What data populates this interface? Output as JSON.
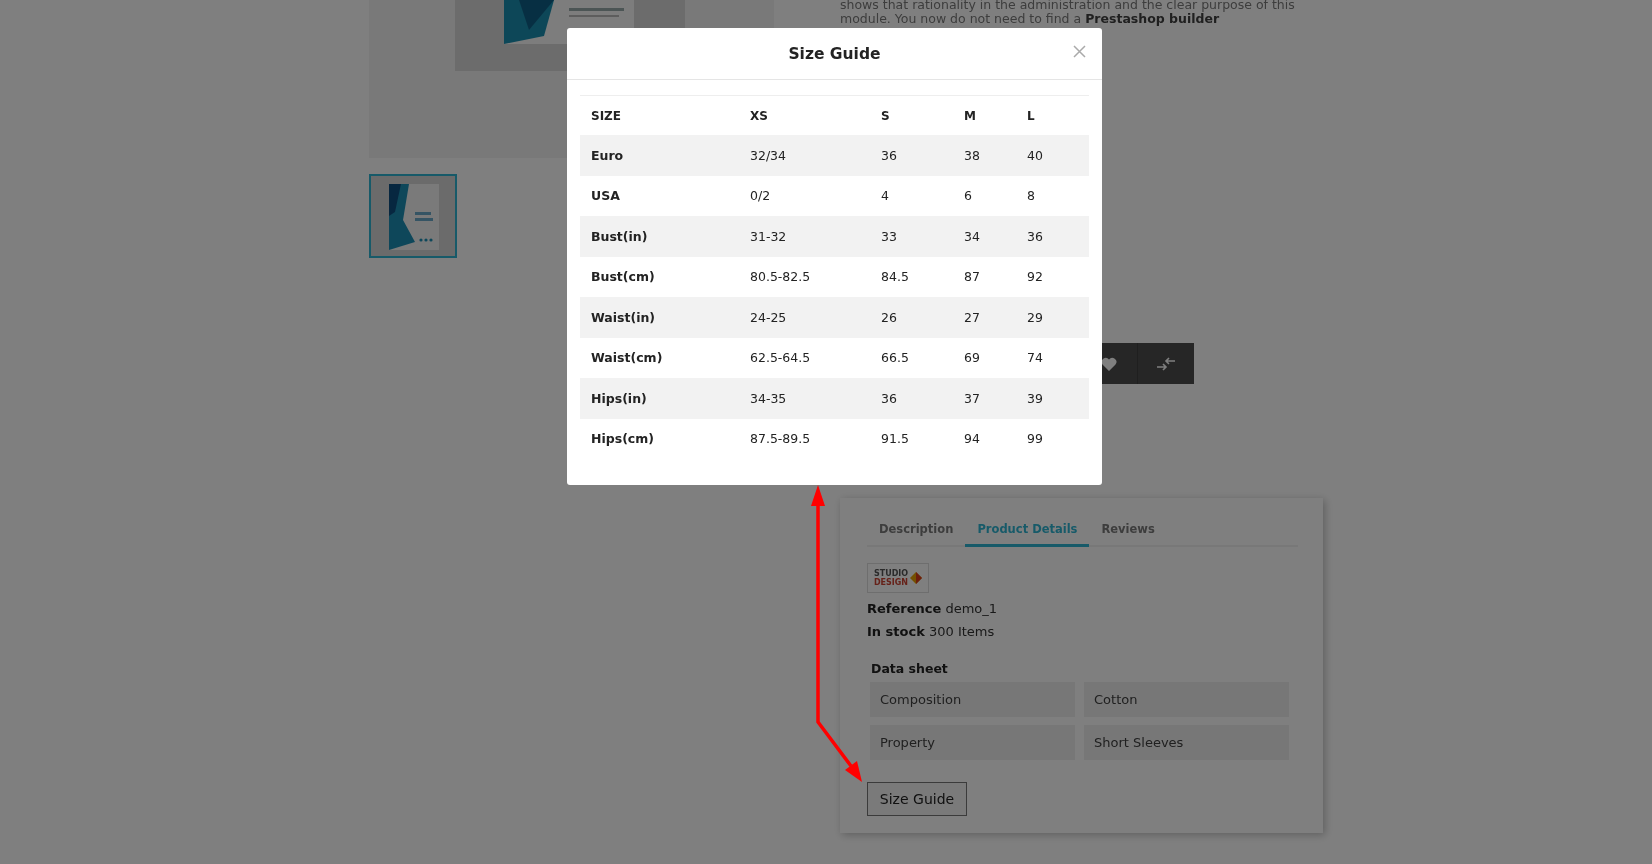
{
  "description_lines": [
    "shows that rationality in the administration and the clear purpose of this",
    "module. You now do not need to find a **Prestashop builder**"
  ],
  "thumbnails": [
    {
      "kind": "picture",
      "selected": true
    }
  ],
  "modal": {
    "title": "Size Guide",
    "table": {
      "columns": [
        "SIZE",
        "XS",
        "S",
        "M",
        "L"
      ],
      "rows": [
        [
          "Euro",
          "32/34",
          "36",
          "38",
          "40"
        ],
        [
          "USA",
          "0/2",
          "4",
          "6",
          "8"
        ],
        [
          "Bust(in)",
          "31-32",
          "33",
          "34",
          "36"
        ],
        [
          "Bust(cm)",
          "80.5-82.5",
          "84.5",
          "87",
          "92"
        ],
        [
          "Waist(in)",
          "24-25",
          "26",
          "27",
          "29"
        ],
        [
          "Waist(cm)",
          "62.5-64.5",
          "66.5",
          "69",
          "74"
        ],
        [
          "Hips(in)",
          "34-35",
          "36",
          "37",
          "39"
        ],
        [
          "Hips(cm)",
          "87.5-89.5",
          "91.5",
          "94",
          "99"
        ]
      ]
    }
  },
  "tabs": [
    {
      "label": "Description",
      "selected": false
    },
    {
      "label": "Product Details",
      "selected": true
    },
    {
      "label": "Reviews",
      "selected": false
    }
  ],
  "brand_logo": {
    "line_1": "STUDIO",
    "line_2": "DESIGN"
  },
  "reference": {
    "label": "Reference",
    "value": "demo_1"
  },
  "stock": {
    "label": "In stock",
    "value": "300 Items"
  },
  "data_sheet": {
    "title": "Data sheet",
    "rows": [
      {
        "name": "Composition",
        "value": "Cotton"
      },
      {
        "name": "Property",
        "value": "Short Sleeves"
      }
    ]
  },
  "size_guide_button": "Size Guide"
}
